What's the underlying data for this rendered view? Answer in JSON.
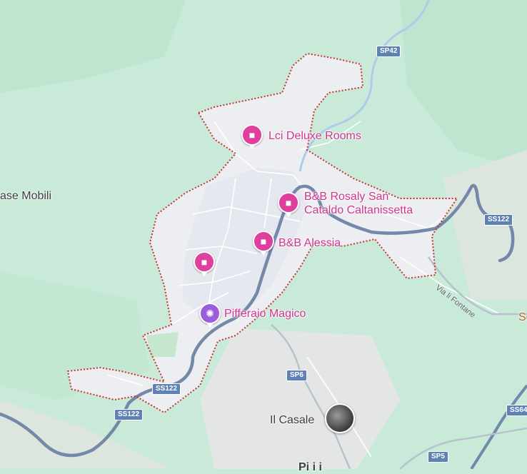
{
  "map": {
    "colors": {
      "land": "#c9ead9",
      "urban": "#eceef2",
      "boundary": "#c9342c",
      "highway": "#6f86a8",
      "river": "#aecbe8",
      "poi": "#d0338d"
    },
    "pois": [
      {
        "name": "Lci Deluxe Rooms",
        "icon": "bed-icon"
      },
      {
        "name": "B&B Rosaly San\nCataldo Caltanissetta",
        "icon": "bed-icon"
      },
      {
        "name": "B&B Alessia",
        "icon": "bed-icon"
      },
      {
        "name": "",
        "icon": "bed-icon"
      },
      {
        "name": "Pifferaio Magico",
        "icon": "amusement-park-icon"
      }
    ],
    "places": {
      "mobili": "ase Mobili",
      "casale": "Il Casale",
      "edge_right": "Se",
      "bottom": "Pi i i"
    },
    "streets": {
      "fontane": "Via li Fontane"
    },
    "roads": {
      "sp42": "SP42",
      "ss122_east": "SS122",
      "ss122_mid": "SS122",
      "ss122_west": "SS122",
      "sp6": "SP6",
      "ss64": "SS64",
      "sp5": "SP5"
    }
  }
}
